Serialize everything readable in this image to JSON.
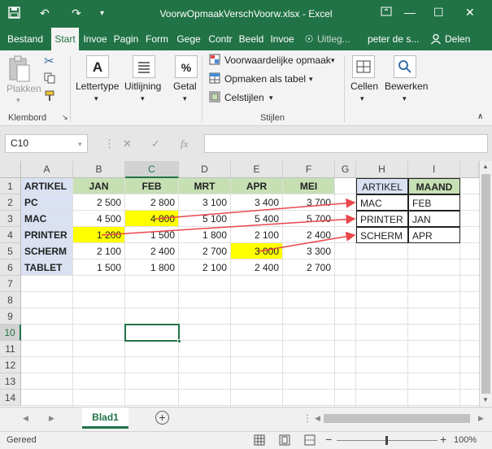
{
  "window": {
    "title": "VoorwOpmaakVerschVoorw.xlsx  -  Excel",
    "minimize_icon": "minimize-icon",
    "restore_icon": "restore-icon",
    "close_icon": "close-icon"
  },
  "qat": {
    "save_icon": "save-icon",
    "undo_icon": "undo-icon",
    "redo_icon": "redo-icon",
    "customize_icon": "chevron-down-icon"
  },
  "tabs": [
    "Bestand",
    "Start",
    "Invoe",
    "Pagin",
    "Form",
    "Gege",
    "Contr",
    "Beeld",
    "Invoe"
  ],
  "tell_me": "Uitleg...",
  "user": "peter de s...",
  "share": "Delen",
  "ribbon": {
    "paste": "Plakken",
    "clipboard_group": "Klembord",
    "font": "Lettertype",
    "alignment": "Uitlijning",
    "number": "Getal",
    "number_symbol": "%",
    "cond_format": "Voorwaardelijke opmaak",
    "format_table": "Opmaken als tabel",
    "cell_styles": "Celstijlen",
    "styles_group": "Stijlen",
    "cells": "Cellen",
    "editing": "Bewerken"
  },
  "formula_bar": {
    "name_box": "C10",
    "fx": "fx",
    "formula": ""
  },
  "columns": [
    "A",
    "B",
    "C",
    "D",
    "E",
    "F",
    "G",
    "H",
    "I"
  ],
  "rows": [
    "1",
    "2",
    "3",
    "4",
    "5",
    "6",
    "7",
    "8",
    "9",
    "10",
    "11",
    "12",
    "13",
    "14"
  ],
  "data_table": {
    "headers": [
      "ARTIKEL",
      "JAN",
      "FEB",
      "MRT",
      "APR",
      "MEI"
    ],
    "rows": [
      {
        "label": "PC",
        "values": [
          "2 500",
          "2 800",
          "3 100",
          "3 400",
          "3 700"
        ]
      },
      {
        "label": "MAC",
        "values": [
          "4 500",
          "4 800",
          "5 100",
          "5 400",
          "5 700"
        ]
      },
      {
        "label": "PRINTER",
        "values": [
          "1 200",
          "1 500",
          "1 800",
          "2 100",
          "2 400"
        ]
      },
      {
        "label": "SCHERM",
        "values": [
          "2 100",
          "2 400",
          "2 700",
          "3 000",
          "3 300"
        ]
      },
      {
        "label": "TABLET",
        "values": [
          "1 500",
          "1 800",
          "2 100",
          "2 400",
          "2 700"
        ]
      }
    ]
  },
  "lookup_table": {
    "headers": [
      "ARTIKEL",
      "MAAND"
    ],
    "rows": [
      [
        "MAC",
        "FEB"
      ],
      [
        "PRINTER",
        "JAN"
      ],
      [
        "SCHERM",
        "APR"
      ]
    ]
  },
  "highlight_color": "#ffff00",
  "header_color": "#c6e0b4",
  "label_color": "#d9e1f2",
  "arrow_color": "#e8474c",
  "sheet_tab": "Blad1",
  "status": {
    "ready": "Gereed",
    "zoom": "100%"
  }
}
